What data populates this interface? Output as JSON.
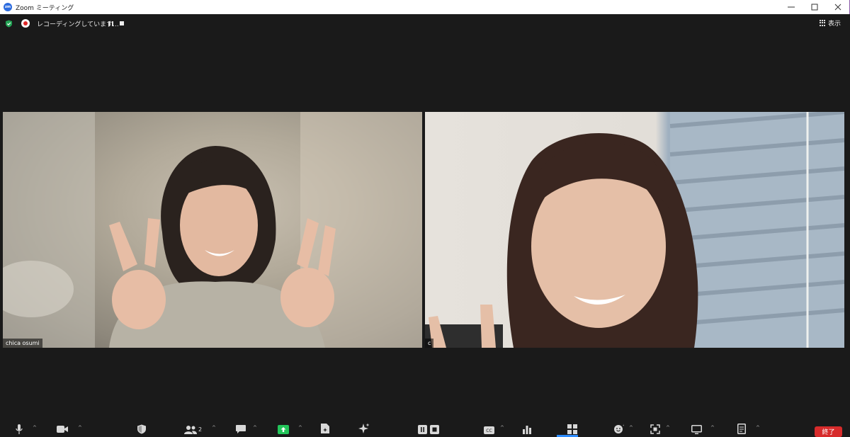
{
  "window": {
    "title": "Zoom ミーティング",
    "app_icon_text": "zm",
    "controls": [
      "minimize",
      "maximize",
      "close"
    ]
  },
  "topbar": {
    "recording_text": "レコーディングしています...",
    "view_label": "表示"
  },
  "participants": [
    {
      "name": "chica osumi"
    },
    {
      "name": "c"
    }
  ],
  "toolbar": {
    "participants_count": "2",
    "end_label": "終了"
  },
  "colors": {
    "accent": "#2d8cff",
    "end_button": "#d72b2b",
    "recording": "#e02828",
    "secure": "#23a455",
    "share": "#23c55a"
  }
}
